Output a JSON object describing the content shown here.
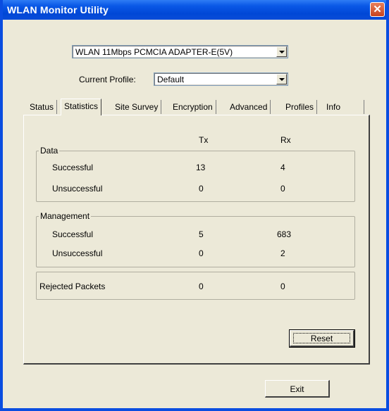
{
  "window": {
    "title": "WLAN Monitor Utility",
    "close_glyph": "✕"
  },
  "adapter": {
    "selected": "WLAN 11Mbps PCMCIA ADAPTER-E(5V)"
  },
  "profile": {
    "label": "Current Profile:",
    "selected": "Default"
  },
  "tabs": [
    "Status",
    "Statistics",
    "Site Survey",
    "Encryption",
    "Advanced",
    "Profiles",
    "Info"
  ],
  "active_tab": "Statistics",
  "stats": {
    "col_tx": "Tx",
    "col_rx": "Rx",
    "data": {
      "title": "Data",
      "rows": [
        {
          "label": "Successful",
          "tx": "13",
          "rx": "4"
        },
        {
          "label": "Unsuccessful",
          "tx": "0",
          "rx": "0"
        }
      ]
    },
    "management": {
      "title": "Management",
      "rows": [
        {
          "label": "Successful",
          "tx": "5",
          "rx": "683"
        },
        {
          "label": "Unsuccessful",
          "tx": "0",
          "rx": "2"
        }
      ]
    },
    "rejected": {
      "label": "Rejected Packets",
      "tx": "0",
      "rx": "0"
    }
  },
  "buttons": {
    "reset": "Reset",
    "exit": "Exit"
  },
  "colors": {
    "titlebar": "#0a58e6",
    "face": "#ece9d8",
    "close": "#d25a33"
  }
}
